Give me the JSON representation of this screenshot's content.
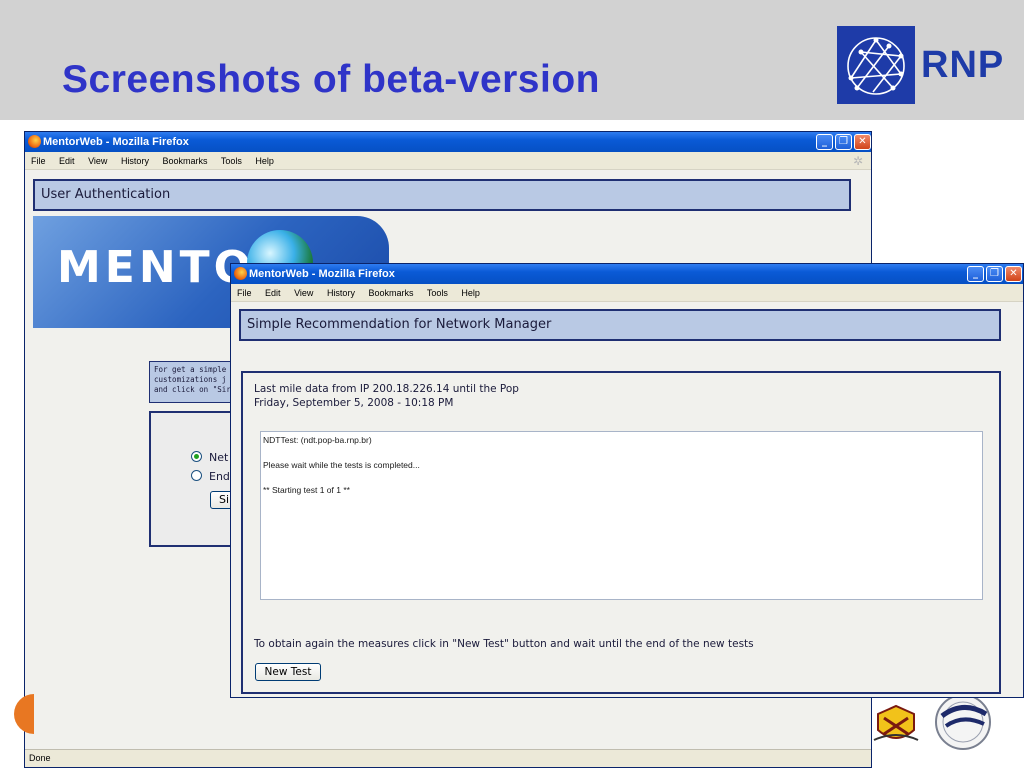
{
  "slide": {
    "title": "Screenshots of beta-version",
    "logo_text": "RNP"
  },
  "colors": {
    "title": "#2f34c8",
    "header_bg": "#d2d2d2",
    "xp_titlebar": "#0a5ad6",
    "section_bg": "#b9c9e4",
    "section_border": "#1f2f72"
  },
  "back_window": {
    "title": "MentorWeb - Mozilla Firefox",
    "menu": [
      "File",
      "Edit",
      "View",
      "History",
      "Bookmarks",
      "Tools",
      "Help"
    ],
    "section_title": "User Authentication",
    "banner_text": "MENTOR",
    "flags": [
      "flag-brazil-icon",
      "flag-usa-icon"
    ],
    "info_lines": [
      "For get a simple",
      "customizations j",
      "and click on \"Sir"
    ],
    "radio_options": [
      {
        "label": "Net",
        "selected": true
      },
      {
        "label": "End",
        "selected": false
      }
    ],
    "button_label": "Si",
    "status_text": "Done"
  },
  "front_window": {
    "title": "MentorWeb - Mozilla Firefox",
    "menu": [
      "File",
      "Edit",
      "View",
      "History",
      "Bookmarks",
      "Tools",
      "Help"
    ],
    "section_title": "Simple Recommendation for Network Manager",
    "data_line": "Last mile data from IP 200.18.226.14 until the Pop",
    "date_line": "Friday, September 5, 2008 - 10:18 PM",
    "output_lines": [
      "NDTTest: (ndt.pop-ba.rnp.br)",
      "Please wait while the tests is completed...",
      "** Starting test 1 of 1 **"
    ],
    "instruction": "To obtain again the measures click in \"New Test\" button and wait until the end of the new tests",
    "new_test_label": "New Test"
  }
}
